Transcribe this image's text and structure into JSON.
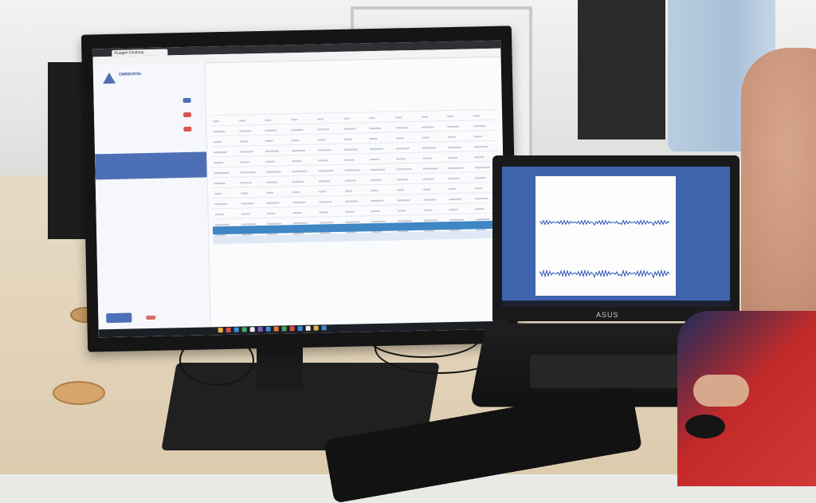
{
  "monitor": {
    "browser_tab": "Ruagen Desktop",
    "logo_text": "OMNIKRON",
    "nav_items": [
      "",
      "",
      "",
      ""
    ],
    "active_item": "",
    "button_label": "",
    "table_columns": [
      "",
      "",
      "",
      "",
      "",
      "",
      "",
      "",
      "",
      "",
      ""
    ],
    "table_rows": 12,
    "taskbar_icon_colors": [
      "#e8b33a",
      "#d9534f",
      "#3c8dde",
      "#41a85f",
      "#f0f0f0",
      "#7a5cc6",
      "#3c8dde",
      "#e87a2e",
      "#41a85f",
      "#d9534f",
      "#3c8dde",
      "#f0f0f0",
      "#e8b33a",
      "#3c8dde"
    ]
  },
  "laptop": {
    "brand": "ASUS",
    "series_color": "#2e55b8"
  },
  "colors": {
    "accent": "#4d6fb5",
    "band": "#3f86c4",
    "desk": "#e3d4bb"
  }
}
